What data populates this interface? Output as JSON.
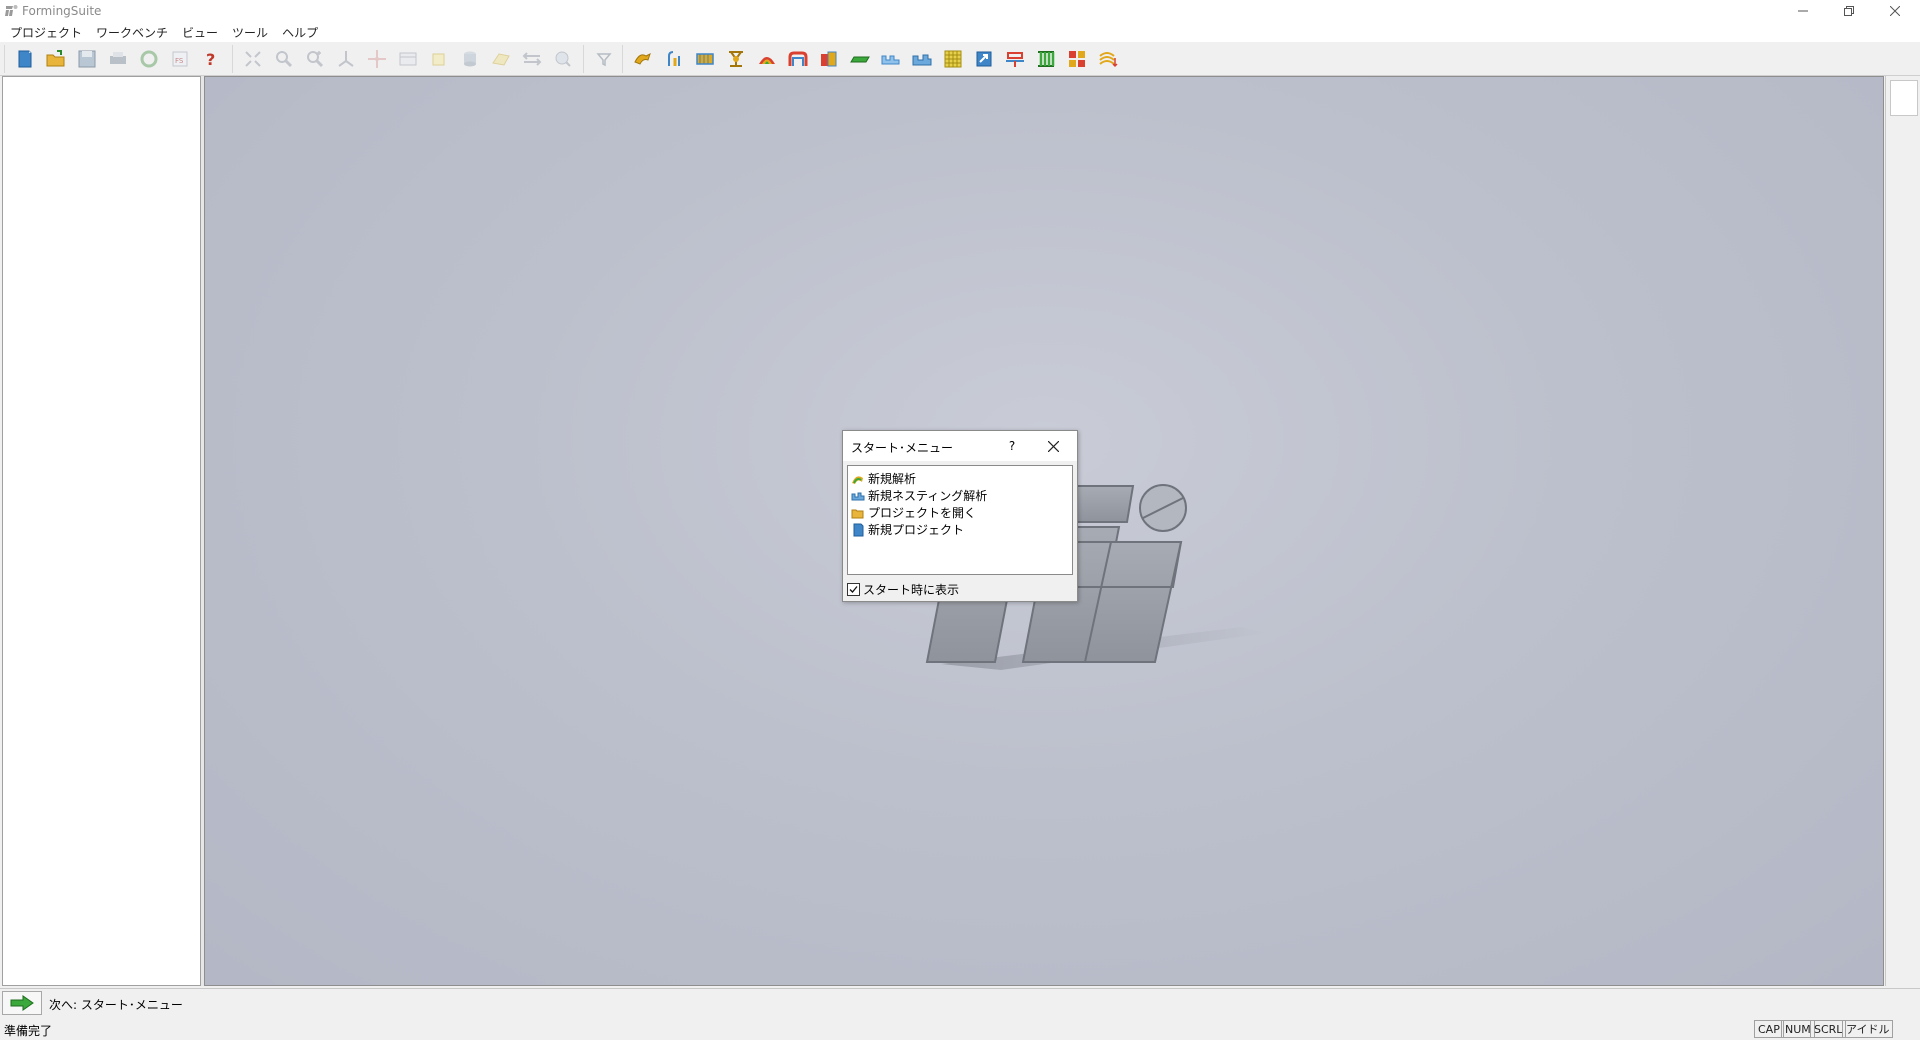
{
  "window": {
    "title": "FormingSuite"
  },
  "menu": {
    "items": [
      "プロジェクト",
      "ワークベンチ",
      "ビュー",
      "ツール",
      "ヘルプ"
    ]
  },
  "toolbar": {
    "file_icons": [
      "new-project-icon",
      "open-folder-icon",
      "save-icon",
      "print-icon",
      "refresh-icon",
      "fs-icon",
      "help-icon"
    ],
    "view_icons": [
      "zoom-fit-icon",
      "zoom-icon",
      "zoom-in-icon",
      "axes-icon",
      "pan-icon",
      "section-icon",
      "box-icon",
      "cylinder-icon",
      "surface-icon",
      "measure-icon",
      "inspect-icon"
    ],
    "filter_icons": [
      "filter-icon"
    ],
    "workbench_icons": [
      "flower-icon",
      "roll-icon",
      "strip-icon",
      "stand-icon",
      "analysis-icon",
      "bend-icon",
      "material-icon",
      "plate-icon",
      "profile-icon",
      "nest-icon",
      "grid-icon",
      "transfer-icon",
      "section-cut-icon",
      "columns-icon",
      "layout-icon",
      "report-icon"
    ]
  },
  "dialog": {
    "title": "スタート･メニュー",
    "help_label": "?",
    "items": [
      {
        "icon": "new-analysis-icon",
        "label": "新規解析"
      },
      {
        "icon": "new-nesting-icon",
        "label": "新規ネスティング解析"
      },
      {
        "icon": "open-project-icon",
        "label": "プロジェクトを開く"
      },
      {
        "icon": "new-project-icon",
        "label": "新規プロジェクト"
      }
    ],
    "show_on_start_label": "スタート時に表示",
    "show_on_start_checked": true
  },
  "nextbar": {
    "label": "次へ: スタート･メニュー"
  },
  "status": {
    "text": "準備完了",
    "indicators": [
      "CAP",
      "NUM",
      "SCRL",
      "アイドル"
    ]
  },
  "colors": {
    "workspace": "#bcc0cc",
    "toolbar_active_gold": "#e1a81c",
    "toolbar_active_blue": "#3f86c9",
    "next_arrow": "#3aa83a"
  }
}
